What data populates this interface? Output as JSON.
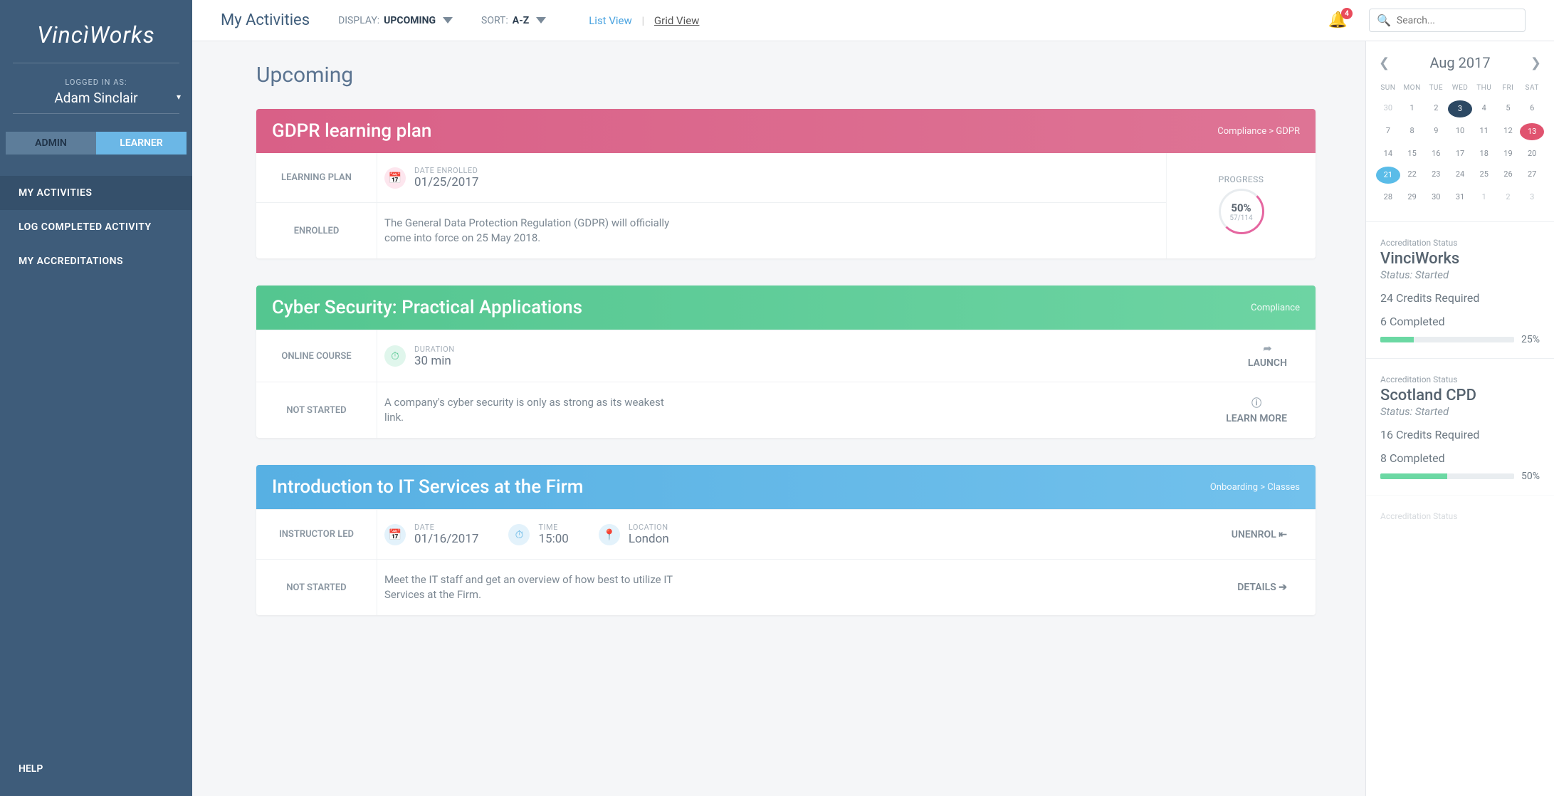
{
  "sidebar": {
    "logo": "VincìWorks",
    "logged_in_label": "LOGGED IN AS:",
    "user_name": "Adam Sinclair",
    "role_admin": "ADMIN",
    "role_learner": "LEARNER",
    "nav": {
      "my_activities": "MY ACTIVITIES",
      "log_completed": "LOG COMPLETED ACTIVITY",
      "my_accreditations": "MY ACCREDITATIONS"
    },
    "help": "HELP"
  },
  "topbar": {
    "title": "My Activities",
    "display_label": "DISPLAY:",
    "display_value": "UPCOMING",
    "sort_label": "SORT:",
    "sort_value": "A-Z",
    "list_view": "List View",
    "grid_view": "Grid View",
    "notification_count": "4",
    "search_placeholder": "Search..."
  },
  "section_title": "Upcoming",
  "cards": [
    {
      "title": "GDPR learning plan",
      "breadcrumb": "Compliance > GDPR",
      "row1_label": "LEARNING PLAN",
      "date_label": "DATE ENROLLED",
      "date_value": "01/25/2017",
      "progress_label": "PROGRESS",
      "progress_pct": "50%",
      "progress_sub": "57/114",
      "row2_label": "ENROLLED",
      "description": "The General Data Protection Regulation (GDPR) will officially come into force on 25 May 2018."
    },
    {
      "title": "Cyber Security: Practical Applications",
      "breadcrumb": "Compliance",
      "row1_label": "ONLINE COURSE",
      "duration_label": "DURATION",
      "duration_value": "30 min",
      "action1": "LAUNCH",
      "row2_label": "NOT STARTED",
      "description": "A company's cyber security is only as strong as its weakest link.",
      "action2": "LEARN MORE"
    },
    {
      "title": "Introduction to IT Services at the Firm",
      "breadcrumb": "Onboarding > Classes",
      "row1_label": "INSTRUCTOR LED",
      "date_label": "DATE",
      "date_value": "01/16/2017",
      "time_label": "TIME",
      "time_value": "15:00",
      "location_label": "LOCATION",
      "location_value": "London",
      "action1": "UNENROL",
      "row2_label": "NOT STARTED",
      "description": "Meet the IT staff and get an overview of how best to utilize IT Services at the Firm.",
      "action2": "DETAILS"
    }
  ],
  "calendar": {
    "month": "Aug 2017",
    "dow": [
      "SUN",
      "MON",
      "TUE",
      "WED",
      "THU",
      "FRI",
      "SAT"
    ],
    "weeks": [
      [
        {
          "d": "30",
          "m": true
        },
        {
          "d": "1"
        },
        {
          "d": "2"
        },
        {
          "d": "3",
          "today": true
        },
        {
          "d": "4"
        },
        {
          "d": "5"
        },
        {
          "d": "6"
        }
      ],
      [
        {
          "d": "7"
        },
        {
          "d": "8"
        },
        {
          "d": "9"
        },
        {
          "d": "10"
        },
        {
          "d": "11"
        },
        {
          "d": "12"
        },
        {
          "d": "13",
          "evt": 1
        }
      ],
      [
        {
          "d": "14"
        },
        {
          "d": "15"
        },
        {
          "d": "16"
        },
        {
          "d": "17"
        },
        {
          "d": "18"
        },
        {
          "d": "19"
        },
        {
          "d": "20"
        }
      ],
      [
        {
          "d": "21",
          "evt": 2
        },
        {
          "d": "22"
        },
        {
          "d": "23"
        },
        {
          "d": "24"
        },
        {
          "d": "25"
        },
        {
          "d": "26"
        },
        {
          "d": "27"
        }
      ],
      [
        {
          "d": "28"
        },
        {
          "d": "29"
        },
        {
          "d": "30"
        },
        {
          "d": "31"
        },
        {
          "d": "1",
          "m": true
        },
        {
          "d": "2",
          "m": true
        },
        {
          "d": "3",
          "m": true
        }
      ]
    ]
  },
  "accreditations": [
    {
      "label": "Accreditation Status",
      "name": "VinciWorks",
      "status": "Status: Started",
      "required": "24 Credits Required",
      "completed": "6 Completed",
      "pct": "25%",
      "pct_num": 25
    },
    {
      "label": "Accreditation Status",
      "name": "Scotland CPD",
      "status": "Status: Started",
      "required": "16 Credits Required",
      "completed": "8 Completed",
      "pct": "50%",
      "pct_num": 50
    }
  ],
  "accred_footer_label": "Accreditation Status"
}
